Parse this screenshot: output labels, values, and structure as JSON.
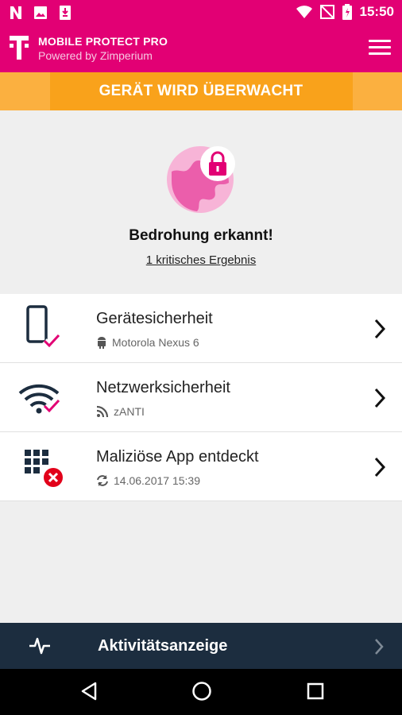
{
  "status_bar": {
    "time": "15:50"
  },
  "app": {
    "title": "MOBILE PROTECT PRO",
    "subtitle": "Powered by Zimperium"
  },
  "banner": {
    "text": "GERÄT WIRD ÜBERWACHT"
  },
  "threat": {
    "title": "Bedrohung erkannt!",
    "link": "1 kritisches Ergebnis"
  },
  "items": [
    {
      "title": "Gerätesicherheit",
      "subtitle": "Motorola Nexus 6",
      "icon": "phone-check-icon",
      "sub_icon": "android-icon"
    },
    {
      "title": "Netzwerksicherheit",
      "subtitle": "zANTI",
      "icon": "wifi-check-icon",
      "sub_icon": "rss-icon"
    },
    {
      "title": "Maliziöse App entdeckt",
      "subtitle": "14.06.2017 15:39",
      "icon": "apps-error-icon",
      "sub_icon": "sync-icon"
    }
  ],
  "bottom_bar": {
    "label": "Aktivitätsanzeige"
  },
  "colors": {
    "brand": "#e20074",
    "banner": "#f9a21b",
    "footer": "#1c2d3f",
    "error": "#e2001a"
  }
}
